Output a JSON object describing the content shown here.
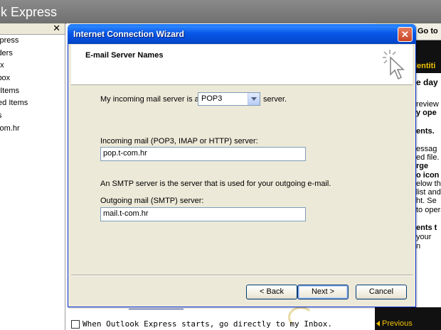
{
  "app": {
    "title": "k Express"
  },
  "folders": [
    "xpress",
    "lders",
    "ox",
    "ibox",
    "t Items",
    "ted Items",
    "ts",
    "com.hr"
  ],
  "right_pane": {
    "goto": "Go to",
    "identity": "lentiti",
    "tips": [
      "e day",
      "",
      "review",
      "y ope",
      "",
      "ents.",
      "",
      "essag",
      "ed file.",
      "rge",
      "o icon",
      "elow th",
      "list and",
      "ht. Se",
      "to opera",
      "ents t",
      "your",
      "n"
    ],
    "previous": "Previous"
  },
  "startup": {
    "text": "When Outlook Express starts, go directly to my Inbox."
  },
  "wizard": {
    "title": "Internet Connection Wizard",
    "close": "✕",
    "heading": "E-mail Server Names",
    "incoming_prefix": "My incoming mail server is a",
    "incoming_type": "POP3",
    "incoming_suffix": "server.",
    "incoming_label": "Incoming mail (POP3, IMAP or HTTP) server:",
    "incoming_value": "pop.t-com.hr",
    "smtp_info": "An SMTP server is the server that is used for your outgoing e-mail.",
    "outgoing_label": "Outgoing mail (SMTP) server:",
    "outgoing_value": "mail.t-com.hr",
    "back": "< Back",
    "next": "Next >",
    "cancel": "Cancel"
  }
}
